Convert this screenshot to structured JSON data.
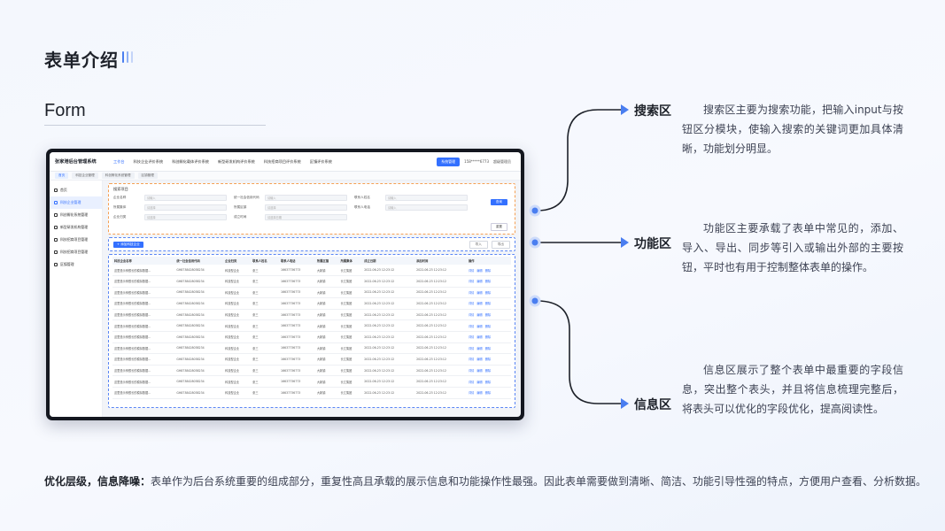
{
  "page": {
    "title": "表单介绍",
    "subtitle": "Form"
  },
  "app": {
    "brand": "张家港后台管理系统",
    "nav": [
      "工作台",
      "科技企业评价系统",
      "科创孵化载体评价系统",
      "新型研发机构评价系统",
      "科技招商项目评价系统",
      "区镇评价系统"
    ],
    "system_button": "系统管理",
    "phone": "158*****6773",
    "user": "超级管理员",
    "breadcrumbs": [
      "首页",
      "科技企业管理",
      "科创孵化系统管理",
      "区镇管理"
    ],
    "sidebar": [
      "首页",
      "科技企业管理",
      "科创孵化系统管理",
      "新型研发机构管理",
      "科技招商项目管理",
      "科技招商项目管理",
      "区镇管理"
    ],
    "search": {
      "title": "搜索项目",
      "fields": [
        {
          "label": "企业名称",
          "placeholder": "请输入"
        },
        {
          "label": "统一社会信用代码",
          "placeholder": "请输入"
        },
        {
          "label": "联系人姓名",
          "placeholder": "请输入"
        },
        {
          "label": "所属集体",
          "placeholder": "请选择"
        },
        {
          "label": "所属区镇",
          "placeholder": "请选择"
        },
        {
          "label": "联系人电话",
          "placeholder": "请输入"
        },
        {
          "label": "企业归类",
          "placeholder": "请选择"
        },
        {
          "label": "成立时间",
          "placeholder": "请选择日期"
        }
      ],
      "query_button": "查询",
      "reset_button": "重置"
    },
    "actions": {
      "add": "+ 添加科技企业",
      "import": "导入",
      "export": "导出"
    },
    "table": {
      "headers": [
        "科技企业名称",
        "统一社会信用代码",
        "企业归类",
        "联系人姓名",
        "联系人电话",
        "所属区镇",
        "所属集体",
        "成立日期",
        "添加时间",
        "操作"
      ],
      "row": [
        "这里是示例很长的模拟数据...",
        "GH8738428038234",
        "科技型企业",
        "张三",
        "16637736773",
        "大新镇",
        "长江集团",
        "2022-06-23 12:23:12",
        "2022-06-23 12:23:12"
      ],
      "row_actions": [
        "详情",
        "编辑",
        "删除"
      ]
    }
  },
  "callouts": [
    {
      "label": "搜索区",
      "desc": "搜索区主要为搜索功能，把输入input与按钮区分模块，使输入搜索的关键词更加具体清晰，功能划分明显。"
    },
    {
      "label": "功能区",
      "desc": "功能区主要承载了表单中常见的，添加、导入、导出、同步等引入或输出外部的主要按钮，平时也有用于控制整体表单的操作。"
    },
    {
      "label": "信息区",
      "desc": "信息区展示了整个表单中最重要的字段信息，突出整个表头，并且将信息梳理完整后，将表头可以优化的字段优化，提高阅读性。"
    }
  ],
  "footer": {
    "bold": "优化层级，信息降噪：",
    "text": "表单作为后台系统重要的组成部分，重复性高且承载的展示信息和功能操作性最强。因此表单需要做到清晰、简洁、功能引导性强的特点，方便用户查看、分析数据。"
  },
  "colors": {
    "accent": "#3370ff",
    "search_outline": "#f5a054",
    "func_outline": "#5a86f5"
  }
}
